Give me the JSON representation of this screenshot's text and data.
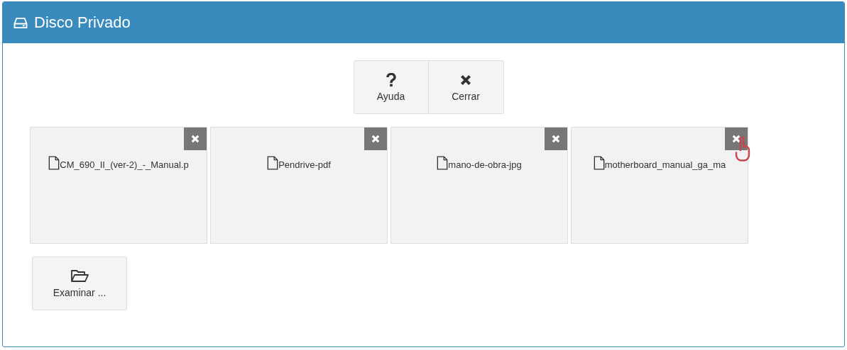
{
  "panel": {
    "title": "Disco Privado"
  },
  "toolbar": [
    {
      "kind": "help",
      "label": "Ayuda"
    },
    {
      "kind": "close",
      "label": "Cerrar"
    }
  ],
  "files": [
    {
      "name": "CM_690_II_(ver-2)_-_Manual.p"
    },
    {
      "name": "Pendrive-pdf"
    },
    {
      "name": "mano-de-obra-jpg"
    },
    {
      "name": "motherboard_manual_ga_ma",
      "hovered": true
    }
  ],
  "browse_button": {
    "label": "Examinar ..."
  }
}
